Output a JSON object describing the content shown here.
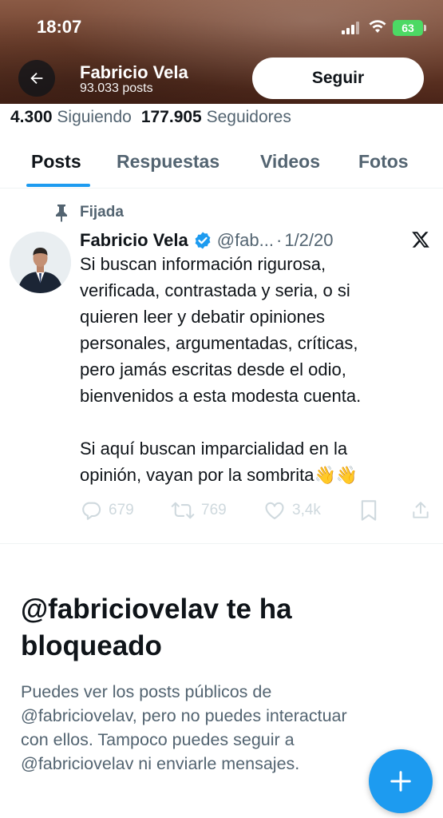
{
  "status_bar": {
    "time": "18:07",
    "battery": "63"
  },
  "header": {
    "name": "Fabricio Vela",
    "posts": "93.033 posts",
    "follow_label": "Seguir"
  },
  "stats": {
    "following_count": "4.300",
    "following_label": "Siguiendo",
    "followers_count": "177.905",
    "followers_label": "Seguidores"
  },
  "tabs": [
    {
      "label": "Posts",
      "active": true
    },
    {
      "label": "Respuestas",
      "active": false
    },
    {
      "label": "Videos",
      "active": false
    },
    {
      "label": "Fotos",
      "active": false
    }
  ],
  "pinned_post": {
    "pinned_label": "Fijada",
    "author": "Fabricio Vela",
    "handle": "@fab...",
    "separator": "·",
    "date": "1/2/20",
    "text_lines": [
      "Si buscan información rigurosa,",
      "verificada, contrastada y seria, o si",
      "quieren leer y debatir opiniones",
      "personales, argumentadas, críticas,",
      "pero jamás escritas desde el odio,",
      "bienvenidos a esta modesta cuenta.",
      "",
      "Si aquí buscan imparcialidad en la",
      "opinión, vayan por la sombrita👋👋"
    ],
    "replies": "679",
    "reposts": "769",
    "likes": "3,4k"
  },
  "blocked": {
    "title": "@fabriciovelav te ha bloqueado",
    "description_lines": [
      "Puedes ver los posts públicos de",
      "@fabriciovelav, pero no puedes interactuar",
      "con ellos. Tampoco puedes seguir a",
      "@fabriciovelav ni enviarle mensajes."
    ]
  },
  "colors": {
    "accent": "#1d9bf0",
    "verified": "#1d9bf0",
    "muted": "#536471",
    "disabled": "#cfd9de"
  },
  "icons": [
    "back-arrow-icon",
    "pin-icon",
    "verified-badge-icon",
    "x-logo-icon",
    "reply-icon",
    "repost-icon",
    "like-icon",
    "bookmark-icon",
    "share-icon",
    "compose-plus-icon"
  ]
}
